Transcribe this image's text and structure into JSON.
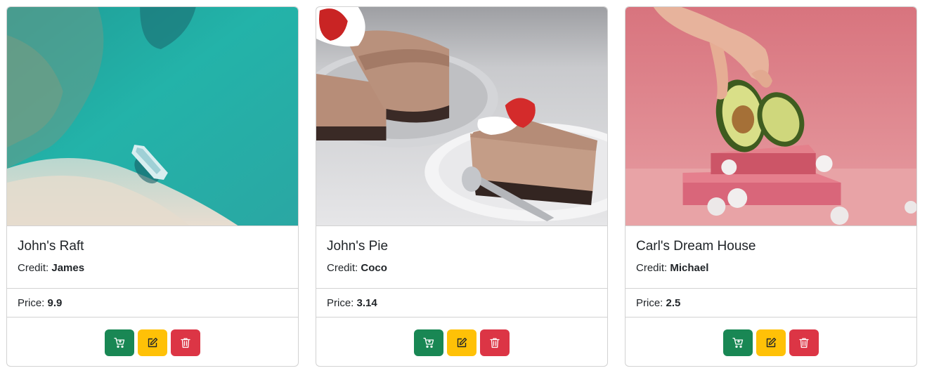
{
  "labels": {
    "credit_prefix": "Credit: ",
    "price_prefix": "Price: "
  },
  "colors": {
    "cart_button": "#198754",
    "edit_button": "#ffc107",
    "delete_button": "#dc3545"
  },
  "icons": {
    "cart": "cart-plus-icon",
    "edit": "pencil-square-icon",
    "delete": "trash-icon"
  },
  "products": [
    {
      "title": "John's Raft",
      "credit": "James",
      "price": "9.9",
      "image": "aerial-boat-turquoise-water-photo"
    },
    {
      "title": "John's Pie",
      "credit": "Coco",
      "price": "3.14",
      "image": "chocolate-cheesecake-strawberry-photo"
    },
    {
      "title": "Carl's Dream House",
      "credit": "Michael",
      "price": "2.5",
      "image": "avocado-pink-pedestal-photo"
    }
  ]
}
